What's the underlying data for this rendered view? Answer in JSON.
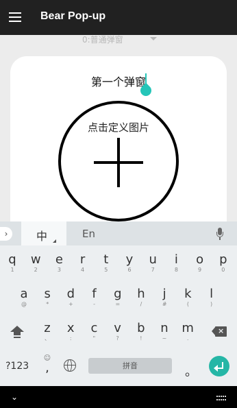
{
  "appbar": {
    "title": "Bear Pop-up",
    "menu_icon": "hamburger-menu-icon"
  },
  "dropdown": {
    "value": "0:普通弹窗"
  },
  "card": {
    "title_input_value": "第一个弹窗",
    "image_picker_label": "点击定义图片"
  },
  "keyboard": {
    "tabs": {
      "chinese": "中",
      "english": "En"
    },
    "row1": [
      {
        "key": "q",
        "hint": "1"
      },
      {
        "key": "w",
        "hint": "2"
      },
      {
        "key": "e",
        "hint": "3"
      },
      {
        "key": "r",
        "hint": "4"
      },
      {
        "key": "t",
        "hint": "5"
      },
      {
        "key": "y",
        "hint": "6"
      },
      {
        "key": "u",
        "hint": "7"
      },
      {
        "key": "i",
        "hint": "8"
      },
      {
        "key": "o",
        "hint": "9"
      },
      {
        "key": "p",
        "hint": "0"
      }
    ],
    "row2": [
      {
        "key": "a",
        "hint": "@"
      },
      {
        "key": "s",
        "hint": "*"
      },
      {
        "key": "d",
        "hint": "+"
      },
      {
        "key": "f",
        "hint": "-"
      },
      {
        "key": "g",
        "hint": "="
      },
      {
        "key": "h",
        "hint": "/"
      },
      {
        "key": "j",
        "hint": "#"
      },
      {
        "key": "k",
        "hint": "("
      },
      {
        "key": "l",
        "hint": ")"
      }
    ],
    "row3": [
      {
        "key": "z",
        "hint": "、"
      },
      {
        "key": "x",
        "hint": ":"
      },
      {
        "key": "c",
        "hint": "\""
      },
      {
        "key": "v",
        "hint": "?"
      },
      {
        "key": "b",
        "hint": "!"
      },
      {
        "key": "n",
        "hint": "~"
      },
      {
        "key": "m",
        "hint": "."
      }
    ],
    "bottom": {
      "symbols_label": "?123",
      "emoji_top": "☺",
      "comma": ",",
      "space_label": "拼音",
      "period": "。"
    }
  },
  "navbar": {
    "back": "⌄"
  },
  "colors": {
    "appbar": "#212121",
    "accent": "#25c5b8",
    "enter": "#25b6a6"
  }
}
